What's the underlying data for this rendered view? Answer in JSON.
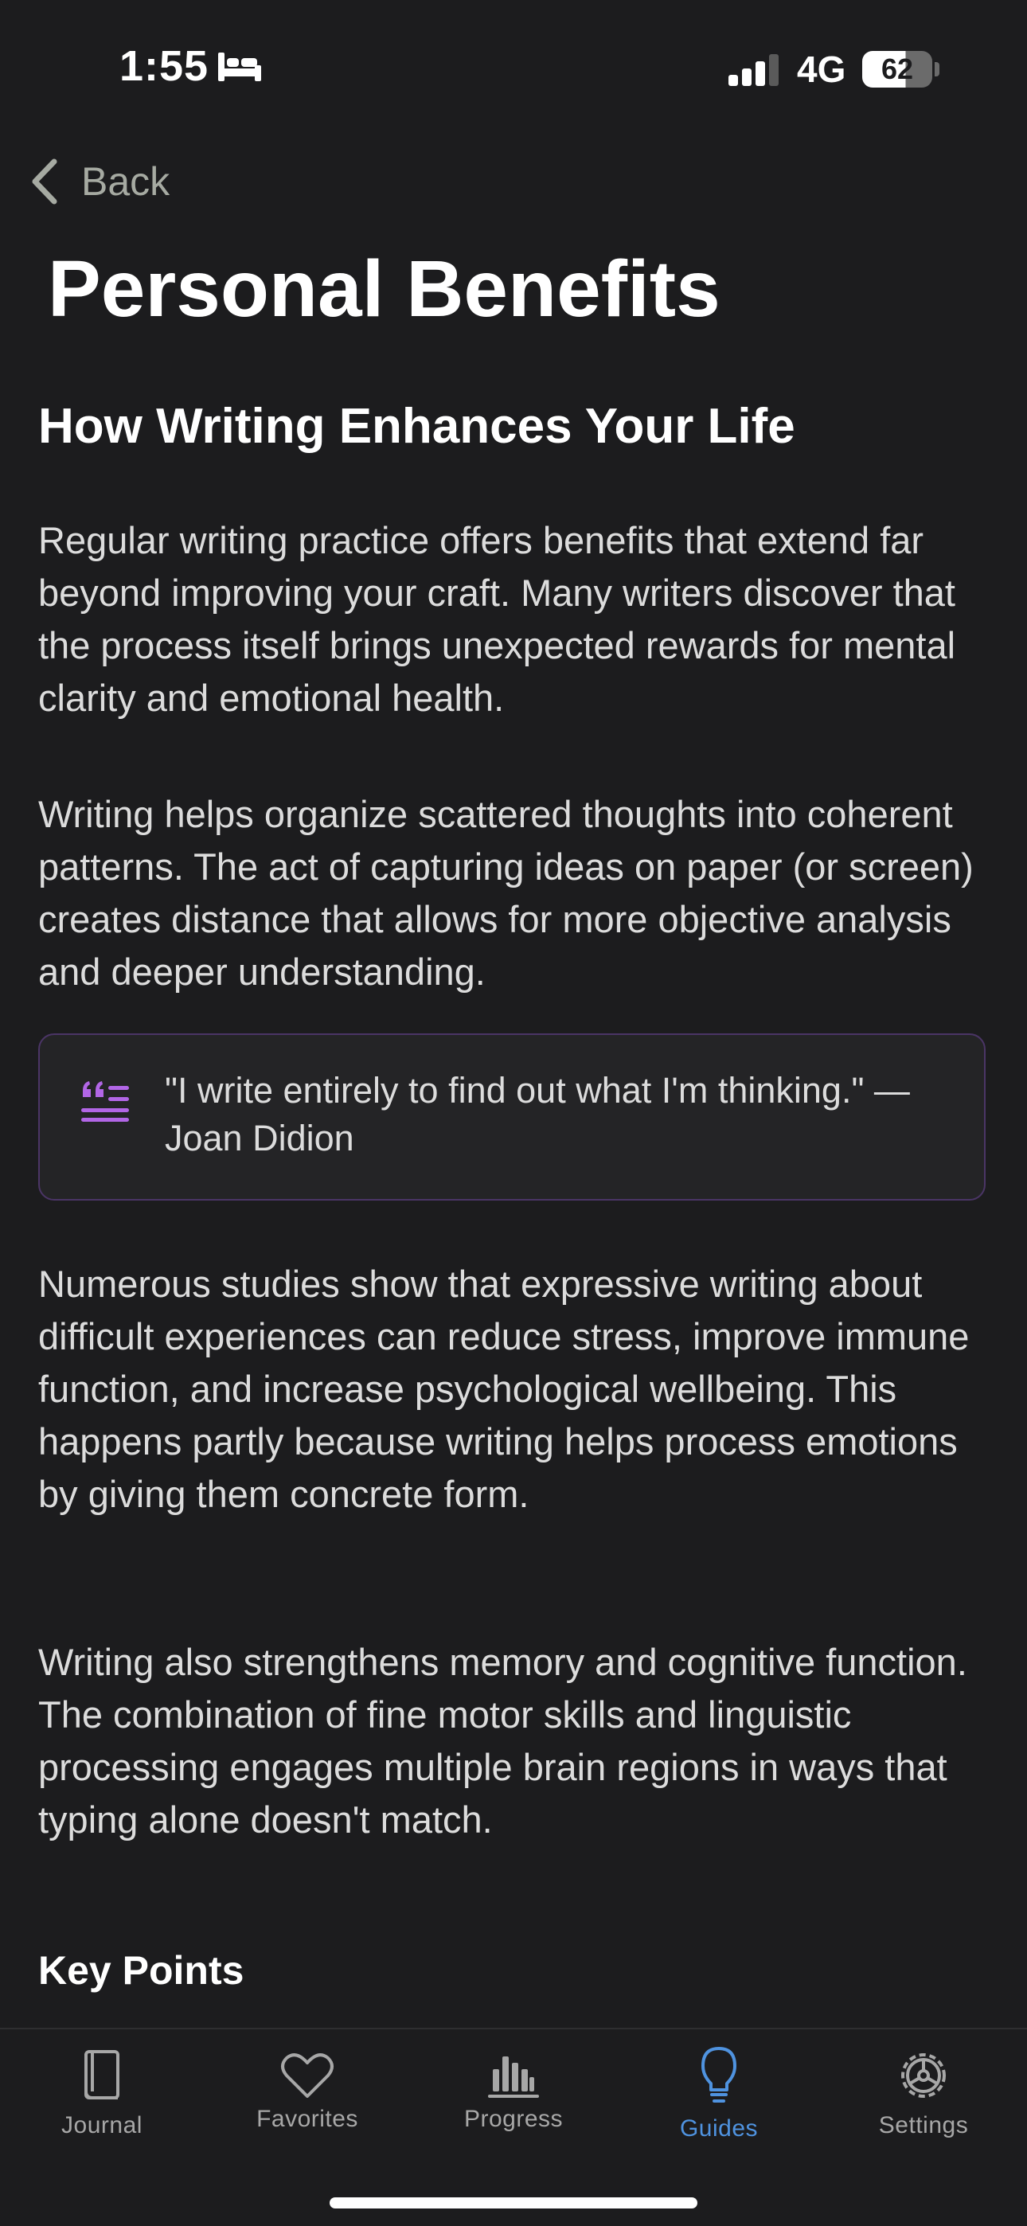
{
  "status_bar": {
    "time": "1:55",
    "network": "4G",
    "battery_percent": "62",
    "battery_level": 0.62,
    "icons": [
      "bed-icon",
      "cellular-signal-icon",
      "battery-icon"
    ]
  },
  "nav": {
    "back_label": "Back",
    "back_icon": "chevron-left-icon"
  },
  "page": {
    "title": "Personal Benefits",
    "section_heading": "How Writing Enhances Your Life",
    "paragraphs": [
      "Regular writing practice offers benefits that extend far beyond improving your craft. Many writers discover that the process itself brings unexpected rewards for mental clarity and emotional health.",
      "Writing helps organize scattered thoughts into coherent patterns. The act of capturing ideas on paper (or screen) creates distance that allows for more objective analysis and deeper understanding.",
      "Numerous studies show that expressive writing about difficult experiences can reduce stress, improve immune function, and increase psychological wellbeing. This happens partly because writing helps process emotions by giving them concrete form.",
      "Writing also strengthens memory and cognitive function. The combination of fine motor skills and linguistic processing engages multiple brain regions in ways that typing alone doesn't match."
    ],
    "quote": {
      "text": "\"I write entirely to find out what I'm thinking.\" — Joan Didion",
      "icon": "quote-icon"
    },
    "key_points_heading": "Key Points"
  },
  "tab_bar": {
    "tabs": [
      {
        "label": "Journal",
        "icon": "book-icon",
        "active": false
      },
      {
        "label": "Favorites",
        "icon": "heart-icon",
        "active": false
      },
      {
        "label": "Progress",
        "icon": "bar-chart-icon",
        "active": false
      },
      {
        "label": "Guides",
        "icon": "lightbulb-icon",
        "active": true
      },
      {
        "label": "Settings",
        "icon": "gear-icon",
        "active": false
      }
    ]
  },
  "colors": {
    "background": "#1c1c1e",
    "accent_active_tab": "#4f93e0",
    "quote_accent": "#b266e6",
    "quote_border": "#4b3566",
    "back_text": "#a6aaa2"
  }
}
